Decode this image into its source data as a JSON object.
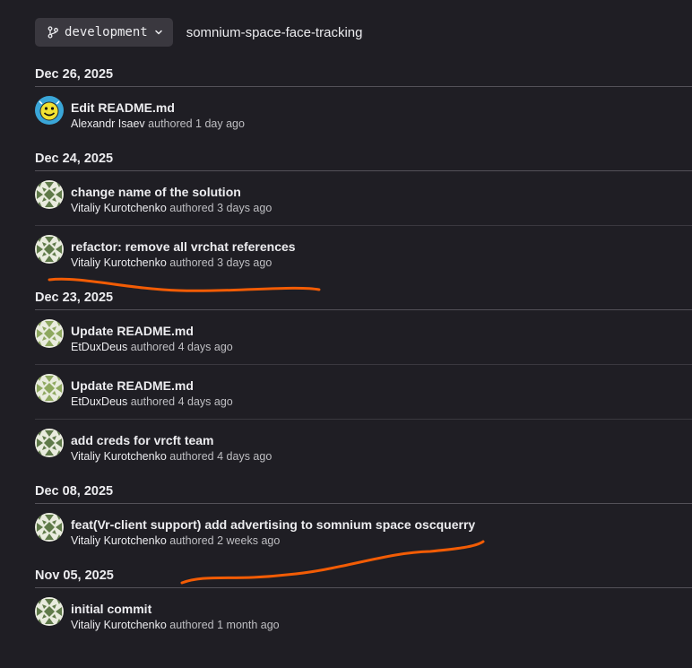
{
  "header": {
    "branch": "development",
    "repo_path": "somnium-space-face-tracking"
  },
  "days": [
    {
      "date": "Dec 26, 2025",
      "commits": [
        {
          "title": "Edit README.md",
          "author": "Alexandr Isaev",
          "action": "authored",
          "time": "1 day ago",
          "avatar": "smiley"
        }
      ]
    },
    {
      "date": "Dec 24, 2025",
      "commits": [
        {
          "title": "change name of the solution",
          "author": "Vitaliy Kurotchenko",
          "action": "authored",
          "time": "3 days ago",
          "avatar": "identicon-dark"
        },
        {
          "title": "refactor: remove all vrchat references",
          "author": "Vitaliy Kurotchenko",
          "action": "authored",
          "time": "3 days ago",
          "avatar": "identicon-dark"
        }
      ]
    },
    {
      "date": "Dec 23, 2025",
      "commits": [
        {
          "title": "Update README.md",
          "author": "EtDuxDeus",
          "action": "authored",
          "time": "4 days ago",
          "avatar": "identicon-light"
        },
        {
          "title": "Update README.md",
          "author": "EtDuxDeus",
          "action": "authored",
          "time": "4 days ago",
          "avatar": "identicon-light"
        },
        {
          "title": "add creds for vrcft team",
          "author": "Vitaliy Kurotchenko",
          "action": "authored",
          "time": "4 days ago",
          "avatar": "identicon-dark"
        }
      ]
    },
    {
      "date": "Dec 08, 2025",
      "commits": [
        {
          "title": "feat(Vr-client support) add advertising to somnium space oscquerry",
          "author": "Vitaliy Kurotchenko",
          "action": "authored",
          "time": "2 weeks ago",
          "avatar": "identicon-dark"
        }
      ]
    },
    {
      "date": "Nov 05, 2025",
      "commits": [
        {
          "title": "initial commit",
          "author": "Vitaliy Kurotchenko",
          "action": "authored",
          "time": "1 month ago",
          "avatar": "identicon-dark"
        }
      ]
    }
  ],
  "colors": {
    "background": "#1f1e24",
    "annotation": "#f25c05",
    "identicon_dark": "#5f7a49",
    "identicon_light": "#8ea85f"
  }
}
